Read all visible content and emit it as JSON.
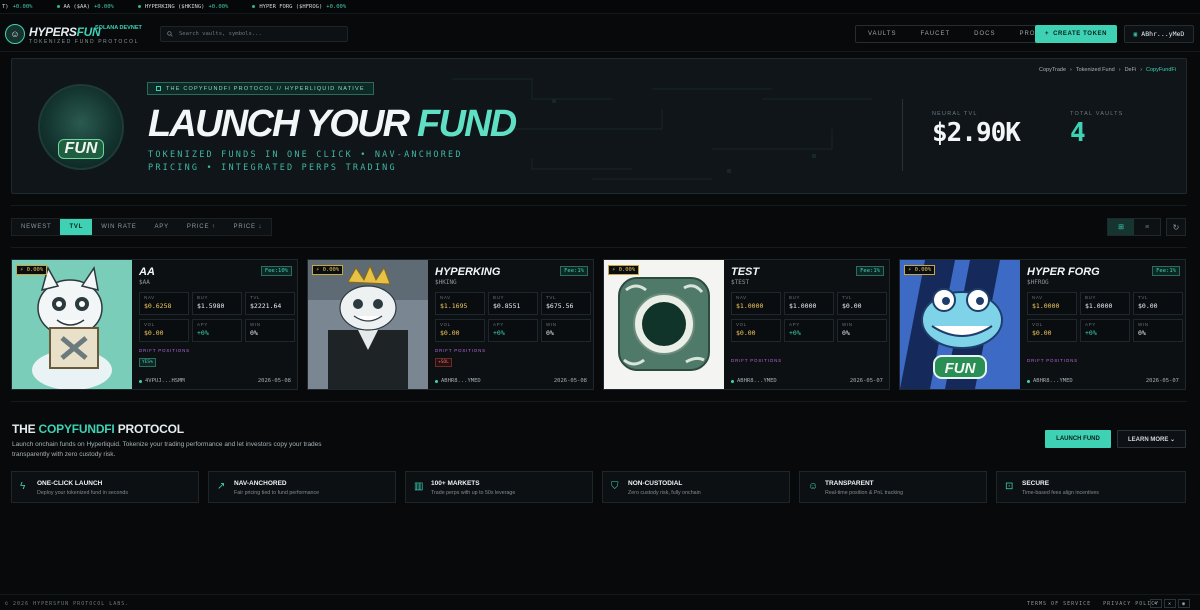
{
  "ticker": [
    {
      "symbol": "T)",
      "change": "+0.00%"
    },
    {
      "symbol": "AA ($AA)",
      "change": "+0.00%"
    },
    {
      "symbol": "HYPERKING ($HKING)",
      "change": "+0.00%"
    },
    {
      "symbol": "HYPER FORG ($HFROG)",
      "change": "+0.00%"
    }
  ],
  "header": {
    "brand_main": "HYPERS",
    "brand_accent": "FUN",
    "network": "SOLANA DEVNET",
    "tagline": "TOKENIZED FUND PROTOCOL",
    "search_placeholder": "Search vaults, symbols...",
    "nav": [
      "VAULTS",
      "FAUCET",
      "DOCS",
      "PROFILE"
    ],
    "create_label": "CREATE TOKEN",
    "wallet": "ABhr...yMeD"
  },
  "hero": {
    "tag": "THE COPYFUNDFI PROTOCOL // HYPERLIQUID NATIVE",
    "title_main": "LAUNCH YOUR ",
    "title_accent": "FUND",
    "subtitle": "TOKENIZED FUNDS IN ONE CLICK • NAV-ANCHORED PRICING • INTEGRATED PERPS TRADING",
    "avatar_badge": "FUN",
    "breadcrumbs": [
      "CopyTrade",
      "Tokenized Fund",
      "DeFi",
      "CopyFundFi"
    ],
    "stats": [
      {
        "label": "NEURAL TVL",
        "value": "$2.90K"
      },
      {
        "label": "TOTAL VAULTS",
        "value": "4"
      }
    ]
  },
  "filters": {
    "items": [
      "NEWEST",
      "TVL",
      "WIN RATE",
      "APY",
      "PRICE ↑",
      "PRICE ↓"
    ],
    "active": "TVL"
  },
  "vaults": [
    {
      "name": "AA",
      "symbol": "$AA",
      "fee": "Fee:10%",
      "pct": "0.00%",
      "nav": "$0.6258",
      "buy": "$1.5980",
      "tvl": "$2221.64",
      "vol": "$0.00",
      "apy": "+0%",
      "win": "0%",
      "drift_label": "DRIFT POSITIONS",
      "tag": "YES%",
      "owner": "4VPUJ...HSMM",
      "date": "2026-05-08",
      "image": "cat-holding-x-sign"
    },
    {
      "name": "HYPERKING",
      "symbol": "$HKING",
      "fee": "Fee:1%",
      "pct": "0.00%",
      "nav": "$1.1695",
      "buy": "$0.8551",
      "tvl": "$675.56",
      "vol": "$0.00",
      "apy": "+0%",
      "win": "0%",
      "drift_label": "DRIFT POSITIONS",
      "tag": "+SOL",
      "owner": "ABHR8...YMED",
      "date": "2026-05-08",
      "image": "cat-king-suit"
    },
    {
      "name": "TEST",
      "symbol": "$TEST",
      "fee": "Fee:1%",
      "pct": "0.00%",
      "nav": "$1.0000",
      "buy": "$1.0000",
      "tvl": "$0.00",
      "vol": "$0.00",
      "apy": "+0%",
      "win": "0%",
      "drift_label": "DRIFT POSITIONS",
      "tag": "",
      "owner": "ABHR8...YMED",
      "date": "2026-05-07",
      "image": "green-jade-coin"
    },
    {
      "name": "HYPER FORG",
      "symbol": "$HFROG",
      "fee": "Fee:1%",
      "pct": "0.00%",
      "nav": "$1.0000",
      "buy": "$1.0000",
      "tvl": "$0.00",
      "vol": "$0.00",
      "apy": "+0%",
      "win": "0%",
      "drift_label": "DRIFT POSITIONS",
      "tag": "",
      "owner": "ABHR8...YMED",
      "date": "2026-05-07",
      "image": "blue-frog-fun"
    }
  ],
  "cell_labels": {
    "nav": "NAV",
    "buy": "BUY",
    "tvl": "TVL",
    "vol": "VOL",
    "apy": "APY",
    "win": "WIN"
  },
  "protocol": {
    "title_pre": "THE ",
    "title_accent": "COPYFUNDFI",
    "title_post": " PROTOCOL",
    "description": "Launch onchain funds on Hyperliquid. Tokenize your trading performance and let investors copy your trades transparently with zero custody risk.",
    "launch_label": "LAUNCH FUND",
    "learn_label": "LEARN MORE ⌄",
    "features": [
      {
        "icon": "lightning-icon",
        "title": "ONE-CLICK LAUNCH",
        "desc": "Deploy your tokenized fund in seconds"
      },
      {
        "icon": "trend-icon",
        "title": "NAV-ANCHORED",
        "desc": "Fair pricing tied to fund performance"
      },
      {
        "icon": "bars-icon",
        "title": "100+ MARKETS",
        "desc": "Trade perps with up to 50x leverage"
      },
      {
        "icon": "shield-icon",
        "title": "NON-CUSTODIAL",
        "desc": "Zero custody risk, fully onchain"
      },
      {
        "icon": "users-icon",
        "title": "TRANSPARENT",
        "desc": "Real-time position & PnL tracking"
      },
      {
        "icon": "lock-icon",
        "title": "SECURE",
        "desc": "Time-based fees align incentives"
      }
    ]
  },
  "footer": {
    "copyright": "© 2026 HYPERSFUN PROTOCOL LABS.",
    "terms": "TERMS OF SERVICE",
    "privacy": "PRIVACY POLICY",
    "social": [
      "telegram-icon",
      "x-icon",
      "github-icon"
    ]
  },
  "colors": {
    "accent": "#3fd1b4",
    "background": "#07090b",
    "warning": "#f0c65a",
    "drift": "#b06ad8"
  }
}
